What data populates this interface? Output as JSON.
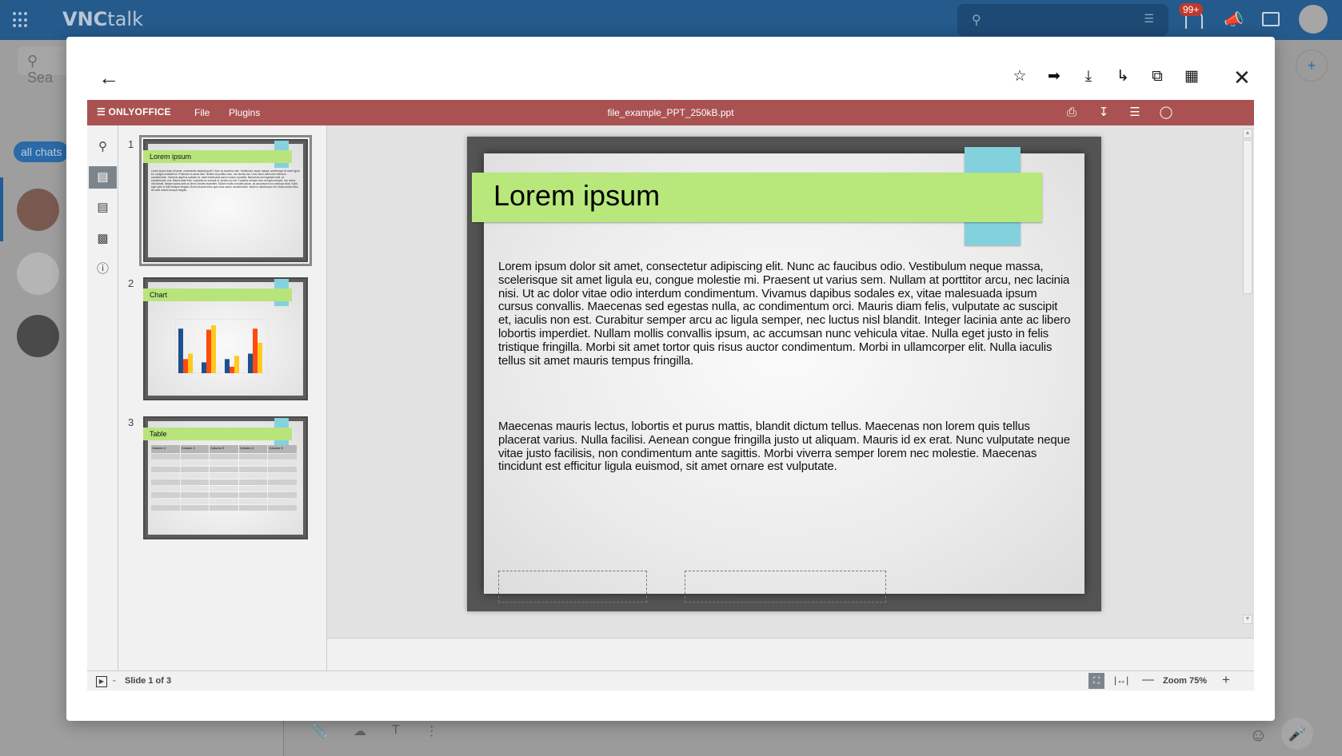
{
  "app": {
    "brand_bold": "VNC",
    "brand_light": "talk",
    "search_placeholder": "Sea",
    "notifications_badge": "99+",
    "filter_label": "all chats"
  },
  "modal": {
    "toolbar_icons": [
      "star-icon",
      "forward-icon",
      "download-icon",
      "reply-icon",
      "copy-icon",
      "apps-icon"
    ]
  },
  "editor": {
    "brand": "ONLYOFFICE",
    "menu": {
      "file": "File",
      "plugins": "Plugins"
    },
    "file_name": "file_example_PPT_250kB.ppt",
    "thumbnails": [
      {
        "num": "1",
        "title": "Lorem ipsum"
      },
      {
        "num": "2",
        "title": "Chart"
      },
      {
        "num": "3",
        "title": "Table"
      }
    ],
    "thumb_table_headers": [
      "Column 1",
      "Column 2",
      "Column 3",
      "Column 4",
      "Column 5"
    ],
    "slide": {
      "title": "Lorem ipsum",
      "paragraph1": "Lorem ipsum dolor sit amet, consectetur adipiscing elit. Nunc ac faucibus odio. Vestibulum neque massa, scelerisque sit amet ligula eu, congue molestie mi. Praesent ut varius sem. Nullam at porttitor arcu, nec lacinia nisi. Ut ac dolor vitae odio interdum condimentum. Vivamus dapibus sodales ex, vitae malesuada ipsum cursus convallis. Maecenas sed egestas nulla, ac condimentum orci. Mauris diam felis, vulputate ac suscipit et, iaculis non est. Curabitur semper arcu ac ligula semper, nec luctus nisl blandit. Integer lacinia ante ac libero lobortis imperdiet. Nullam mollis convallis ipsum, ac accumsan nunc vehicula vitae. Nulla eget justo in felis tristique fringilla. Morbi sit amet tortor quis risus auctor condimentum. Morbi in ullamcorper elit. Nulla iaculis tellus sit amet mauris tempus fringilla.",
      "paragraph2": "Maecenas mauris lectus, lobortis et purus mattis, blandit dictum tellus. Maecenas non lorem quis tellus placerat varius. Nulla facilisi. Aenean congue fringilla justo ut aliquam. Mauris id ex erat. Nunc vulputate neque vitae justo facilisis, non condimentum ante sagittis. Morbi viverra semper lorem nec molestie. Maecenas tincidunt est efficitur ligula euismod, sit amet ornare est vulputate."
    },
    "status": {
      "slide_count": "Slide 1 of 3",
      "zoom": "Zoom 75%"
    },
    "thumb_chart": {
      "colors": [
        "#1d4f91",
        "#ff4a12",
        "#ffc91f"
      ],
      "groups": [
        [
          0.82,
          0.26,
          0.36
        ],
        [
          0.2,
          0.8,
          0.88
        ],
        [
          0.26,
          0.12,
          0.32
        ],
        [
          0.36,
          0.82,
          0.56
        ]
      ]
    }
  },
  "colors": {
    "vnc_blue": "#245a8c",
    "onlyoffice_red": "#aa5252",
    "title_band": "#b8e77c",
    "accent_tab": "#84d1de"
  }
}
